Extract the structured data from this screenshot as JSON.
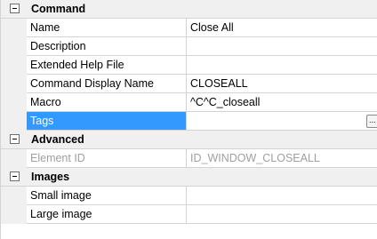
{
  "categories": {
    "command": "Command",
    "advanced": "Advanced",
    "images": "Images"
  },
  "properties": {
    "name": {
      "label": "Name",
      "value": "Close All"
    },
    "description": {
      "label": "Description",
      "value": ""
    },
    "extended_help": {
      "label": "Extended Help File",
      "value": ""
    },
    "display_name": {
      "label": "Command Display Name",
      "value": "CLOSEALL"
    },
    "macro": {
      "label": "Macro",
      "value": "^C^C_closeall"
    },
    "tags": {
      "label": "Tags",
      "value": "",
      "button": "..."
    },
    "element_id": {
      "label": "Element ID",
      "value": "ID_WINDOW_CLOSEALL"
    },
    "small_image": {
      "label": "Small image",
      "value": ""
    },
    "large_image": {
      "label": "Large image",
      "value": ""
    }
  }
}
